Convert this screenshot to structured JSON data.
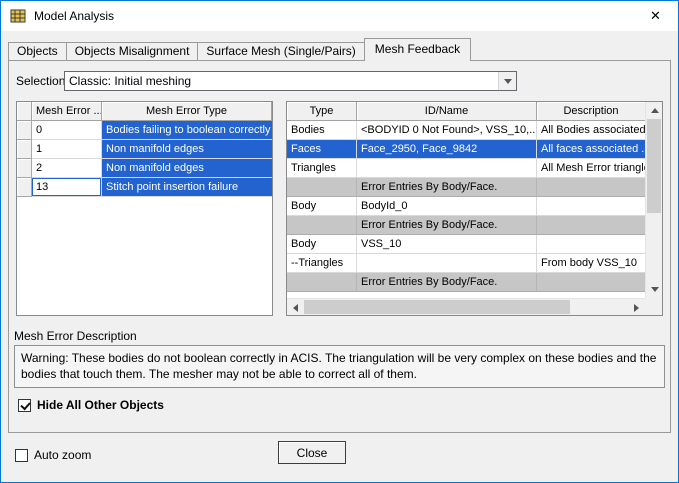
{
  "window": {
    "title": "Model Analysis"
  },
  "icons": {
    "close": "✕"
  },
  "colors": {
    "highlight": "#2263cf",
    "gray_band": "#c6c6c6",
    "window_border": "#0078d7"
  },
  "tabs": [
    {
      "label": "Objects",
      "active": false
    },
    {
      "label": "Objects Misalignment",
      "active": false
    },
    {
      "label": "Surface Mesh (Single/Pairs)",
      "active": false
    },
    {
      "label": "Mesh Feedback",
      "active": true
    }
  ],
  "selection": {
    "label": "Selection:",
    "value": "Classic: Initial meshing"
  },
  "left_table": {
    "headers": [
      "Mesh Error ...",
      "Mesh Error Type"
    ],
    "rows": [
      {
        "id": "0",
        "type": "Bodies failing to boolean correctly",
        "focused": false
      },
      {
        "id": "1",
        "type": "Non manifold edges",
        "focused": false
      },
      {
        "id": "2",
        "type": "Non manifold edges",
        "focused": false
      },
      {
        "id": "13",
        "type": "Stitch point insertion failure",
        "focused": true
      }
    ]
  },
  "right_table": {
    "headers": [
      "Type",
      "ID/Name",
      "Description"
    ],
    "rows": [
      {
        "type": "Bodies",
        "id": "<BODYID 0 Not Found>, VSS_10,...",
        "desc": "All Bodies associated",
        "style": "normal"
      },
      {
        "type": "Faces",
        "id": "Face_2950, Face_9842",
        "desc": "All faces associated ..",
        "style": "selected"
      },
      {
        "type": "Triangles",
        "id": "",
        "desc": "All Mesh Error triangle.",
        "style": "normal"
      },
      {
        "type": "",
        "id": "Error Entries By Body/Face.",
        "desc": "",
        "style": "gray"
      },
      {
        "type": "Body",
        "id": "BodyId_0",
        "desc": "",
        "style": "normal"
      },
      {
        "type": "",
        "id": "Error Entries By Body/Face.",
        "desc": "",
        "style": "gray"
      },
      {
        "type": "Body",
        "id": "VSS_10",
        "desc": "",
        "style": "normal"
      },
      {
        "type": "--Triangles",
        "id": "",
        "desc": "From body VSS_10",
        "style": "normal"
      },
      {
        "type": "",
        "id": "Error Entries By Body/Face.",
        "desc": "",
        "style": "gray"
      }
    ]
  },
  "description": {
    "label": "Mesh Error Description",
    "text": "Warning:  These bodies do not boolean correctly in ACIS.  The triangulation will be very complex on these bodies and the bodies that touch them.  The mesher may not be able to correct all of them."
  },
  "checkboxes": {
    "hide_all": {
      "label": "Hide All Other Objects",
      "checked": true
    },
    "auto_zoom": {
      "label": "Auto zoom",
      "checked": false
    }
  },
  "close_button": "Close"
}
